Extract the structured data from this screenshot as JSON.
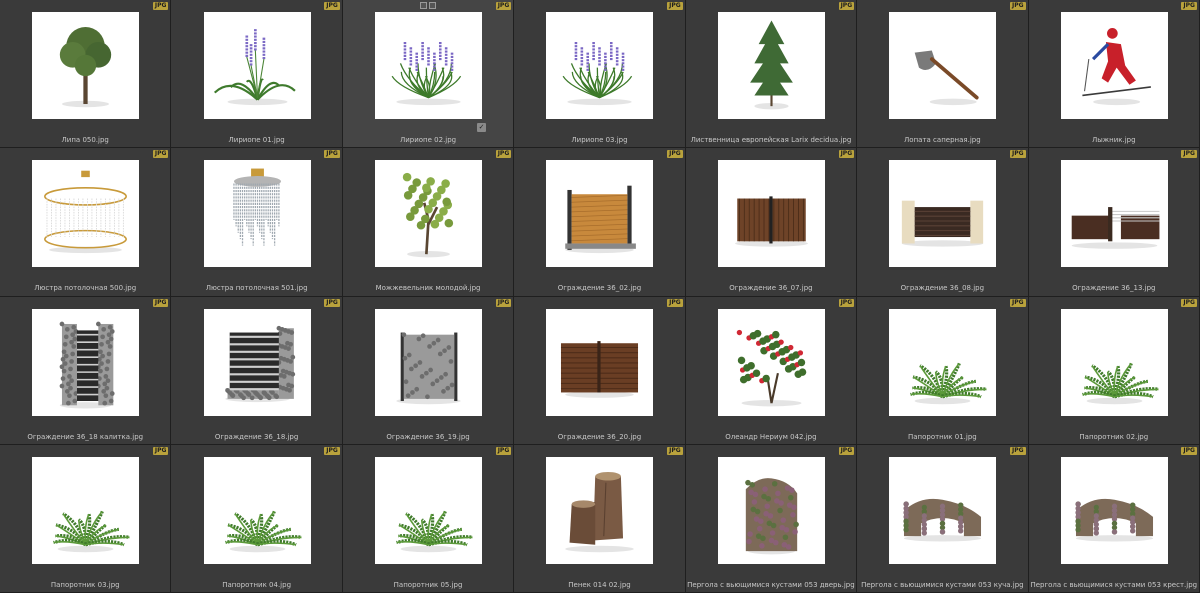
{
  "badge_text": "JPG",
  "colors": {
    "background": "#262626",
    "cell": "#3a3a3a",
    "badge": "#b9a23c",
    "label": "#c8c8c8"
  },
  "items": [
    {
      "filename": "Липа 050.jpg",
      "icon": "tree-icon"
    },
    {
      "filename": "Лириопе 01.jpg",
      "icon": "lavender-plant-icon"
    },
    {
      "filename": "Лириопе 02.jpg",
      "icon": "grass-flower-icon",
      "selected": true
    },
    {
      "filename": "Лириопе 03.jpg",
      "icon": "grass-flower-icon"
    },
    {
      "filename": "Лиственница европейская Larix decidua.jpg",
      "icon": "conifer-icon"
    },
    {
      "filename": "Лопата саперная.jpg",
      "icon": "shovel-icon"
    },
    {
      "filename": "Лыжник.jpg",
      "icon": "skier-icon"
    },
    {
      "filename": "Люстра потолочная 500.jpg",
      "icon": "chandelier-gold-icon"
    },
    {
      "filename": "Люстра потолочная 501.jpg",
      "icon": "chandelier-crystal-icon"
    },
    {
      "filename": "Можжевельник молодой.jpg",
      "icon": "juniper-icon"
    },
    {
      "filename": "Ограждение 36_02.jpg",
      "icon": "wood-fence-icon"
    },
    {
      "filename": "Ограждение 36_07.jpg",
      "icon": "slat-fence-icon"
    },
    {
      "filename": "Ограждение 36_08.jpg",
      "icon": "brick-fence-icon"
    },
    {
      "filename": "Ограждение 36_13.jpg",
      "icon": "rail-fence-icon"
    },
    {
      "filename": "Ограждение 36_18 калитка.jpg",
      "icon": "gabion-gate-icon"
    },
    {
      "filename": "Ограждение 36_18.jpg",
      "icon": "gabion-fence-icon"
    },
    {
      "filename": "Ограждение 36_19.jpg",
      "icon": "gabion-panel-icon"
    },
    {
      "filename": "Ограждение 36_20.jpg",
      "icon": "wood-panel-fence-icon"
    },
    {
      "filename": "Олеандр Нериум 042.jpg",
      "icon": "oleander-icon"
    },
    {
      "filename": "Папоротник 01.jpg",
      "icon": "fern-icon"
    },
    {
      "filename": "Папоротник 02.jpg",
      "icon": "fern-icon"
    },
    {
      "filename": "Папоротник 03.jpg",
      "icon": "fern-icon"
    },
    {
      "filename": "Папоротник 04.jpg",
      "icon": "fern-icon"
    },
    {
      "filename": "Папоротник 05.jpg",
      "icon": "fern-icon"
    },
    {
      "filename": "Пенек 014 02.jpg",
      "icon": "stump-icon"
    },
    {
      "filename": "Пергола с вьющимися кустами 053 дверь.jpg",
      "icon": "pergola-door-icon"
    },
    {
      "filename": "Пергола с вьющимися кустами 053 куча.jpg",
      "icon": "pergola-arch-icon"
    },
    {
      "filename": "Пергола с вьющимися кустами 053 крест.jpg",
      "icon": "pergola-arch-icon"
    }
  ]
}
